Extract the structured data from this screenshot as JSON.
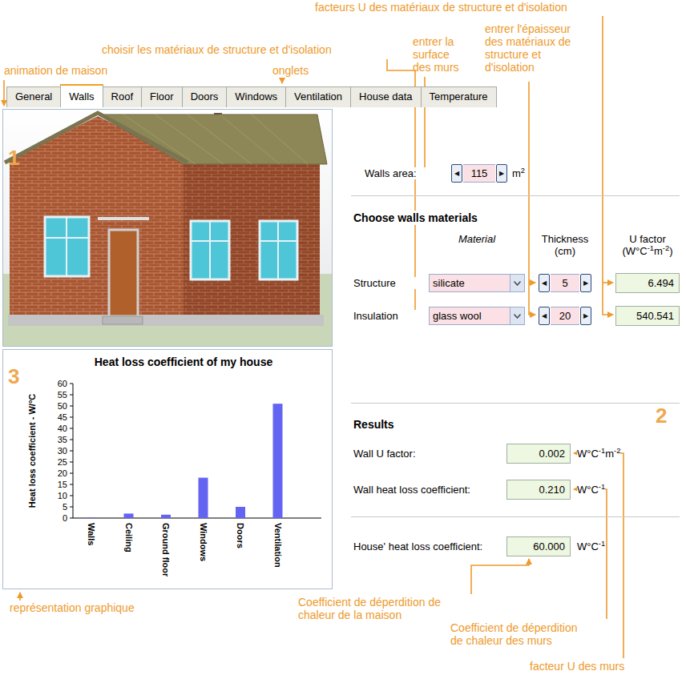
{
  "annotations": [
    {
      "lines": [
        "facteurs U des matériaux de structure et d'isolation"
      ]
    },
    {
      "lines": [
        "choisir les matériaux de structure et d'isolation"
      ]
    },
    {
      "lines": [
        "entrer la",
        "surface",
        "des murs"
      ]
    },
    {
      "lines": [
        "entrer l'épaisseur",
        "des matériaux de",
        "structure et",
        "d'isolation"
      ]
    },
    {
      "lines": [
        "animation de maison"
      ]
    },
    {
      "lines": [
        "onglets"
      ]
    },
    {
      "lines": [
        "représentation graphique"
      ]
    },
    {
      "lines": [
        "Coefficient de déperdition de",
        "chaleur de la maison"
      ]
    },
    {
      "lines": [
        "Coefficient de déperdition",
        "de chaleur des murs"
      ]
    },
    {
      "lines": [
        "facteur U des murs"
      ]
    }
  ],
  "markers": [
    "1",
    "2",
    "3"
  ],
  "tabs": [
    {
      "label": "General",
      "selected": false
    },
    {
      "label": "Walls",
      "selected": true
    },
    {
      "label": "Roof",
      "selected": false
    },
    {
      "label": "Floor",
      "selected": false
    },
    {
      "label": "Doors",
      "selected": false
    },
    {
      "label": "Windows",
      "selected": false
    },
    {
      "label": "Ventilation",
      "selected": false
    },
    {
      "label": "House data",
      "selected": false
    },
    {
      "label": "Temperature",
      "selected": false
    }
  ],
  "spinner_buttons": {
    "decrement": "◀",
    "increment": "▶"
  },
  "walls_area": {
    "label": "Walls area:",
    "value": "115",
    "unit": [
      {
        "t": "m",
        "sup": "2"
      }
    ]
  },
  "materials": {
    "title": "Choose walls materials",
    "headers": {
      "material": "Material",
      "thickness": [
        "Thickness",
        "(cm)"
      ],
      "u_factor": "U factor",
      "u_unit": [
        {
          "t": "(W°C",
          "sup": "-1"
        },
        {
          "t": "m",
          "sup": "-2"
        },
        {
          "t": ")"
        }
      ]
    },
    "rows": [
      {
        "label": "Structure",
        "material": "silicate",
        "thickness": "5",
        "u_factor": "6.494"
      },
      {
        "label": "Insulation",
        "material": "glass wool",
        "thickness": "20",
        "u_factor": "540.541"
      }
    ]
  },
  "results": {
    "title": "Results",
    "rows": [
      {
        "label": "Wall U factor:",
        "value": "0.002",
        "unit": [
          {
            "t": "W°C",
            "sup": "-1"
          },
          {
            "t": "m",
            "sup": "-2"
          }
        ]
      },
      {
        "label": "Wall heat loss coefficient:",
        "value": "0.210",
        "unit": [
          {
            "t": "W°C",
            "sup": "-1"
          }
        ]
      }
    ]
  },
  "house": {
    "label": "House' heat loss coefficient:",
    "value": "60.000",
    "unit": [
      {
        "t": "W°C",
        "sup": "-1"
      }
    ]
  },
  "chart": {
    "title": "Heat loss coefficient of my house",
    "y_label": "Heat loss coefficient - W/°C",
    "ticks": [
      "0",
      "5",
      "10",
      "15",
      "20",
      "25",
      "30",
      "35",
      "40",
      "45",
      "50",
      "55",
      "60"
    ],
    "categories": [
      "Walls",
      "Ceiling",
      "Ground floor",
      "Windows",
      "Doors",
      "Ventilation"
    ],
    "values": [
      0.21,
      2,
      1.5,
      18,
      5,
      51
    ]
  }
}
